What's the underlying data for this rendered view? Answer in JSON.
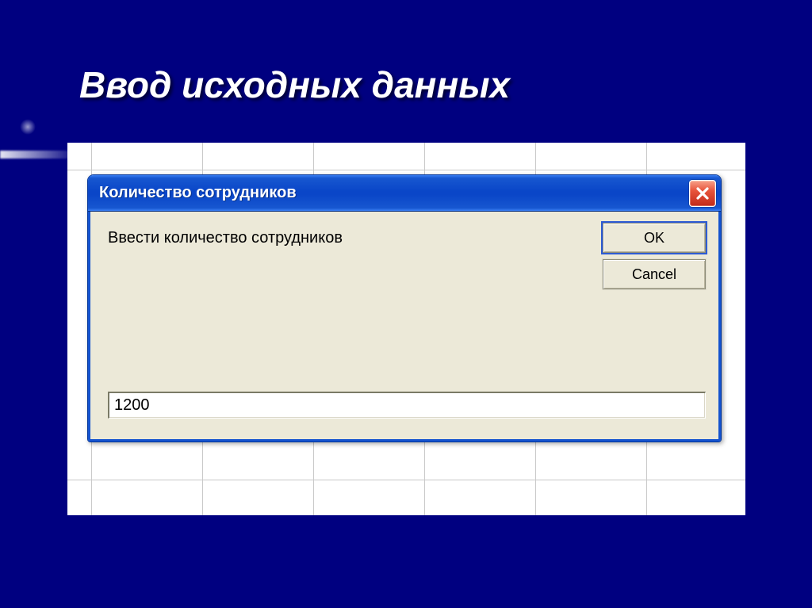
{
  "slide": {
    "title": "Ввод исходных данных"
  },
  "dialog": {
    "title": "Количество сотрудников",
    "prompt": "Ввести количество сотрудников",
    "input_value": "1200",
    "ok_label": "OK",
    "cancel_label": "Cancel"
  }
}
